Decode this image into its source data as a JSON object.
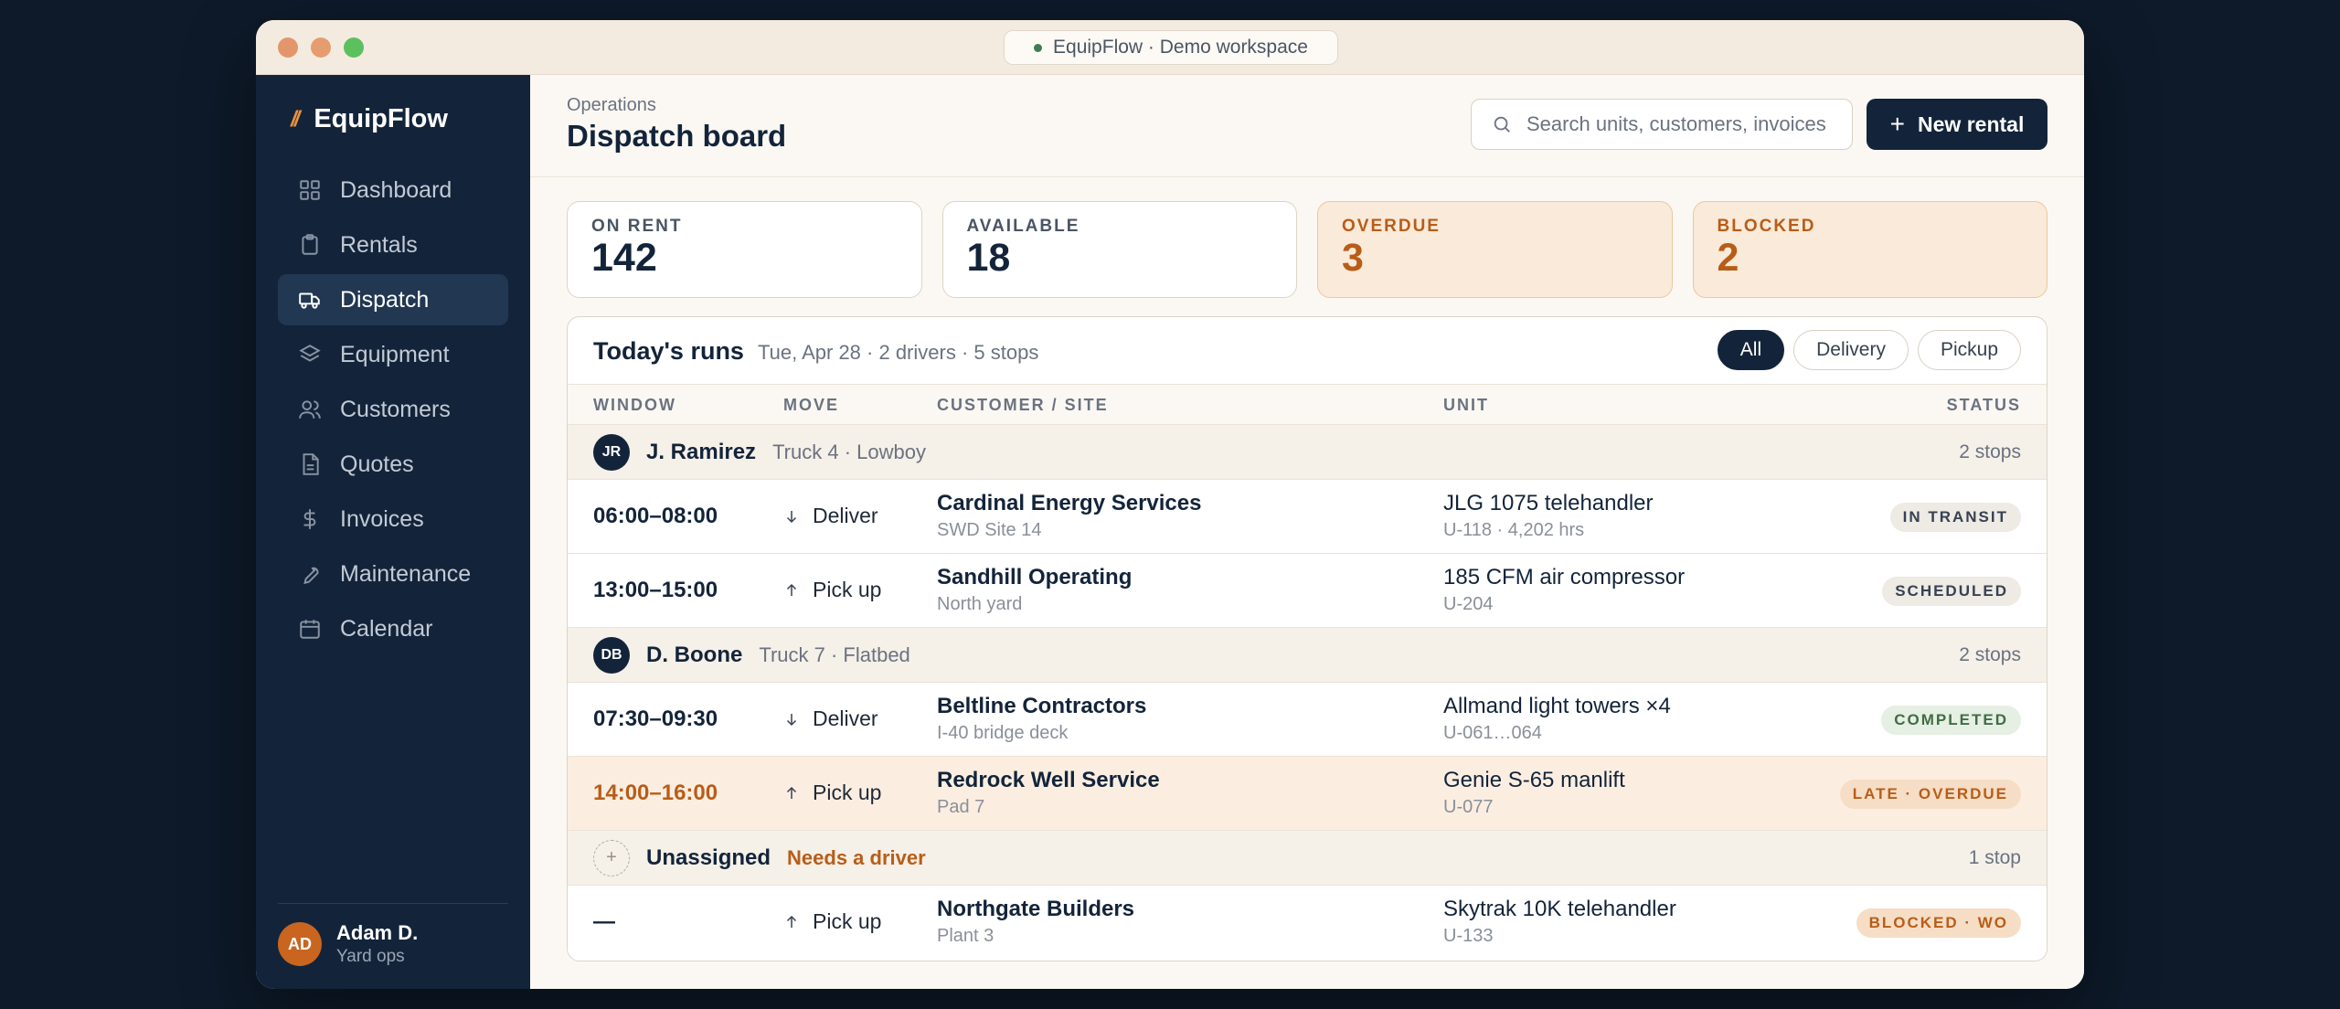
{
  "window": {
    "url_label": "EquipFlow · Demo workspace"
  },
  "brand": {
    "mark": "//",
    "name": "EquipFlow"
  },
  "sidebar": {
    "items": [
      {
        "label": "Dashboard",
        "icon": "grid-icon"
      },
      {
        "label": "Rentals",
        "icon": "clipboard-icon"
      },
      {
        "label": "Dispatch",
        "icon": "truck-icon",
        "active": true
      },
      {
        "label": "Equipment",
        "icon": "layers-icon"
      },
      {
        "label": "Customers",
        "icon": "users-icon"
      },
      {
        "label": "Quotes",
        "icon": "document-icon"
      },
      {
        "label": "Invoices",
        "icon": "dollar-icon"
      },
      {
        "label": "Maintenance",
        "icon": "wrench-icon"
      },
      {
        "label": "Calendar",
        "icon": "calendar-icon"
      }
    ],
    "user": {
      "initials": "AD",
      "name": "Adam D.",
      "role": "Yard ops"
    }
  },
  "header": {
    "breadcrumb": "Operations",
    "title": "Dispatch board",
    "search_placeholder": "Search units, customers, invoices",
    "new_button": "New rental"
  },
  "stats": [
    {
      "label": "ON RENT",
      "value": "142"
    },
    {
      "label": "AVAILABLE",
      "value": "18"
    },
    {
      "label": "OVERDUE",
      "value": "3"
    },
    {
      "label": "BLOCKED",
      "value": "2"
    }
  ],
  "runs": {
    "title": "Today's runs",
    "meta": "Tue, Apr 28 · 2 drivers · 5 stops",
    "filters": [
      "All",
      "Delivery",
      "Pickup"
    ],
    "columns": [
      "WINDOW",
      "MOVE",
      "CUSTOMER / SITE",
      "UNIT",
      "STATUS"
    ],
    "groups": [
      {
        "initials": "JR",
        "name": "J. Ramirez",
        "sub": "Truck 4 · Lowboy",
        "count": "2 stops",
        "rows": [
          {
            "window": "06:00–08:00",
            "move": "Deliver",
            "dir": "down",
            "customer": "Cardinal Energy Services",
            "site": "SWD Site 14",
            "unit": "JLG 1075 telehandler",
            "unit_sub": "U-118 · 4,202 hrs",
            "status": "IN TRANSIT",
            "tone": "grey"
          },
          {
            "window": "13:00–15:00",
            "move": "Pick up",
            "dir": "up",
            "customer": "Sandhill Operating",
            "site": "North yard",
            "unit": "185 CFM air compressor",
            "unit_sub": "U-204",
            "status": "SCHEDULED",
            "tone": "grey"
          }
        ]
      },
      {
        "initials": "DB",
        "name": "D. Boone",
        "sub": "Truck 7 · Flatbed",
        "count": "2 stops",
        "rows": [
          {
            "window": "07:30–09:30",
            "move": "Deliver",
            "dir": "down",
            "customer": "Beltline Contractors",
            "site": "I-40 bridge deck",
            "unit": "Allmand light towers ×4",
            "unit_sub": "U-061…064",
            "status": "COMPLETED",
            "tone": "green"
          },
          {
            "window": "14:00–16:00",
            "move": "Pick up",
            "dir": "up",
            "customer": "Redrock Well Service",
            "site": "Pad 7",
            "unit": "Genie S-65 manlift",
            "unit_sub": "U-077",
            "status": "LATE · OVERDUE",
            "tone": "orange",
            "late": true
          }
        ]
      },
      {
        "initials": "+",
        "name": "Unassigned",
        "sub": "Needs a driver",
        "count": "1 stop",
        "unassigned": true,
        "rows": [
          {
            "window": "—",
            "move": "Pick up",
            "dir": "up",
            "customer": "Northgate Builders",
            "site": "Plant 3",
            "unit": "Skytrak 10K telehandler",
            "unit_sub": "U-133",
            "status": "BLOCKED · WO",
            "tone": "orange"
          }
        ]
      }
    ]
  }
}
